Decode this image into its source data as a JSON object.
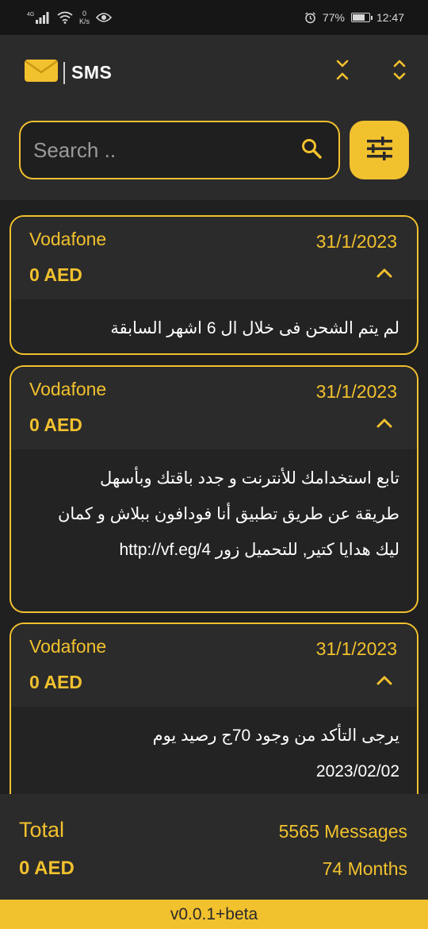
{
  "status_bar": {
    "signal": "4G",
    "net_speed_value": "0",
    "net_speed_unit": "K/s",
    "battery_percent": "77%",
    "battery_level": 0.77,
    "time": "12:47"
  },
  "header": {
    "app_title": "SMS",
    "expand_all_icon": "chevrons-collapse-icon",
    "collapse_all_icon": "chevrons-expand-icon"
  },
  "search": {
    "placeholder": "Search ..",
    "value": ""
  },
  "messages": [
    {
      "sender": "Vodafone",
      "date": "31/1/2023",
      "amount": "0 AED",
      "body": "لم يتم الشحن فى خلال ال 6 اشهر السابقة"
    },
    {
      "sender": "Vodafone",
      "date": "31/1/2023",
      "amount": "0 AED",
      "body_lines": [
        "تابع استخدامك للأنترنت و جدد باقتك وبأسهل",
        "طريقة عن طريق تطبيق أنا فودافون ببلاش و كمان",
        "ليك هدايا كتير, للتحميل زور http://vf.eg/4"
      ]
    },
    {
      "sender": "Vodafone",
      "date": "31/1/2023",
      "amount": "0 AED",
      "body_lines": [
        "يرجى التأكد من وجود 70ج رصيد يوم",
        "2023/02/02"
      ]
    }
  ],
  "footer": {
    "total_label": "Total",
    "total_amount": "0 AED",
    "messages_count": "5565 Messages",
    "months_count": "74 Months"
  },
  "version": "v0.0.1+beta",
  "colors": {
    "accent": "#f2c12e",
    "background": "#202020",
    "surface": "#2b2b2b"
  }
}
